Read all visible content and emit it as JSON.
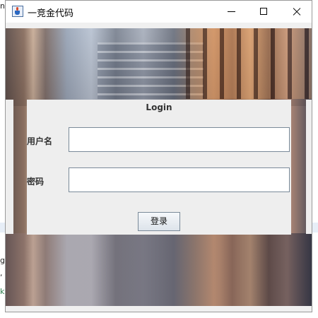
{
  "window": {
    "title": "一竞金代码",
    "icon": "java-cup-icon",
    "controls": {
      "minimize": "minimize-icon",
      "maximize": "maximize-icon",
      "close": "close-icon"
    }
  },
  "login": {
    "title": "Login",
    "username_label": "用户名",
    "username_value": "",
    "password_label": "密码",
    "password_value": "",
    "submit_label": "登录"
  },
  "background": {
    "fragments": [
      "n",
      "g",
      ",",
      "k"
    ]
  },
  "colors": {
    "panel": "#eeeeee",
    "field_border": "#7a8a99",
    "title_text": "#333333"
  }
}
